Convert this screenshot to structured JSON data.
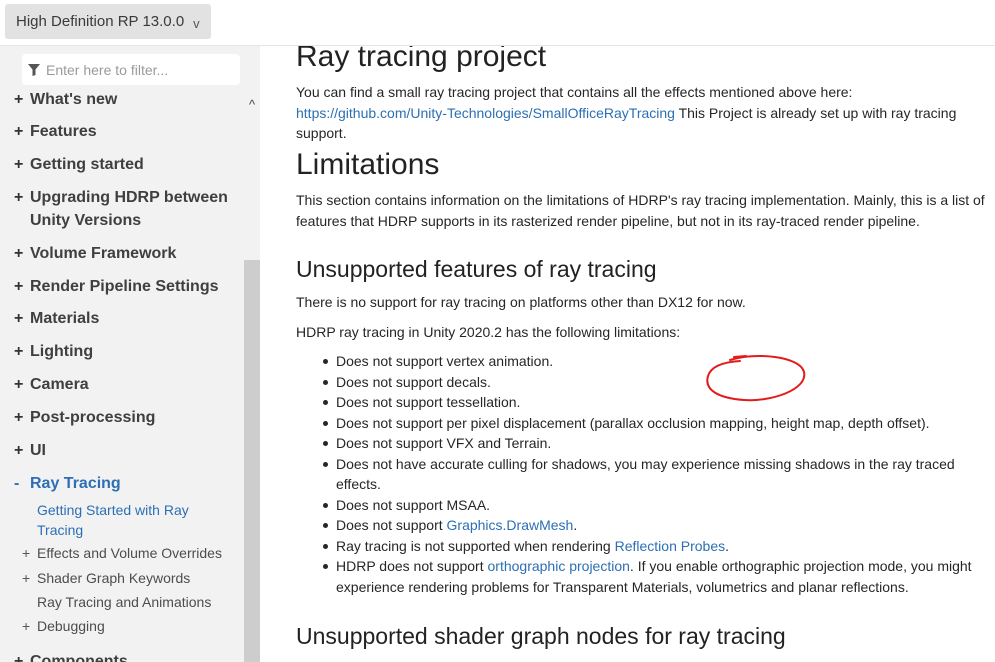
{
  "header": {
    "version_label": "High Definition RP 13.0.0",
    "version_chevron": "v"
  },
  "sidebar": {
    "filter_placeholder": "Enter here to filter...",
    "scroll_up_glyph": "^",
    "items": [
      {
        "marker": "+",
        "label": "What's new"
      },
      {
        "marker": "+",
        "label": "Features"
      },
      {
        "marker": "+",
        "label": "Getting started"
      },
      {
        "marker": "+",
        "label": "Upgrading HDRP between Unity Versions"
      },
      {
        "marker": "+",
        "label": "Volume Framework"
      },
      {
        "marker": "+",
        "label": "Render Pipeline Settings"
      },
      {
        "marker": "+",
        "label": "Materials"
      },
      {
        "marker": "+",
        "label": "Lighting"
      },
      {
        "marker": "+",
        "label": "Camera"
      },
      {
        "marker": "+",
        "label": "Post-processing"
      },
      {
        "marker": "+",
        "label": "UI"
      },
      {
        "marker": "-",
        "label": "Ray Tracing"
      },
      {
        "marker": "+",
        "label": "Components"
      }
    ],
    "sub_items": [
      {
        "marker": "",
        "label": "Getting Started with Ray Tracing"
      },
      {
        "marker": "+",
        "label": "Effects and Volume Overrides"
      },
      {
        "marker": "+",
        "label": "Shader Graph Keywords"
      },
      {
        "marker": "",
        "label": "Ray Tracing and Animations"
      },
      {
        "marker": "+",
        "label": "Debugging"
      }
    ]
  },
  "content": {
    "project_heading": "Ray tracing project",
    "project_text_1": "You can find a small ray tracing project that contains all the effects mentioned above here: ",
    "project_link": "https://github.com/Unity-Technologies/SmallOfficeRayTracing",
    "project_text_2": " This Project is already set up with ray tracing support.",
    "limitations_heading": "Limitations",
    "limitations_text": "This section contains information on the limitations of HDRP's ray tracing implementation. Mainly, this is a list of features that HDRP supports in its rasterized render pipeline, but not in its ray-traced render pipeline.",
    "unsupported_heading": "Unsupported features of ray tracing",
    "dx12_text": "There is no support for ray tracing on platforms other than DX12 for now.",
    "unity_text": "HDRP ray tracing in Unity 2020.2 has the following limitations:",
    "limitations_list": {
      "vertex": "Does not support vertex animation.",
      "decals": "Does not support decals.",
      "tessellation": "Does not support tessellation.",
      "displacement": "Does not support per pixel displacement (parallax occlusion mapping, height map, depth offset).",
      "vfx": "Does not support VFX and Terrain.",
      "culling": "Does not have accurate culling for shadows, you may experience missing shadows in the ray traced effects.",
      "msaa": "Does not support MSAA.",
      "drawmesh_prefix": "Does not support ",
      "drawmesh_link": "Graphics.DrawMesh",
      "drawmesh_suffix": ".",
      "probes_prefix": "Ray tracing is not supported when rendering ",
      "probes_link": "Reflection Probes",
      "probes_suffix": ".",
      "ortho_prefix": "HDRP does not support ",
      "ortho_link": "orthographic projection",
      "ortho_suffix": ". If you enable orthographic projection mode, you might experience rendering problems for Transparent Materials, volumetrics and planar reflections."
    },
    "shader_heading": "Unsupported shader graph nodes for ray tracing"
  },
  "colors": {
    "link": "#2c6fb4",
    "annotation": "#e21b1b"
  }
}
